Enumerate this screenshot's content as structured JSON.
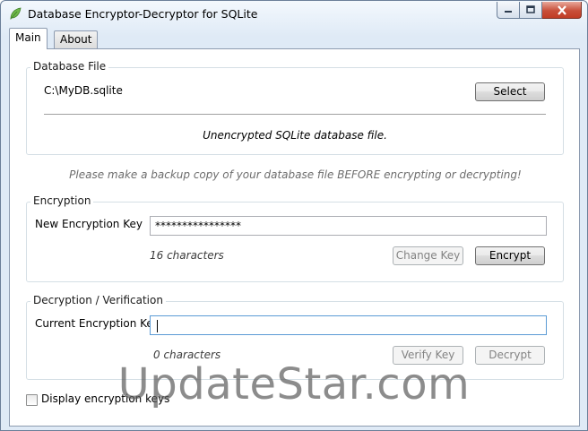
{
  "window": {
    "title": "Database Encryptor-Decryptor for SQLite",
    "icon": "leaf-icon",
    "close_color": "#c8503a"
  },
  "tabs": [
    {
      "label": "Main",
      "selected": true
    },
    {
      "label": "About",
      "selected": false
    }
  ],
  "database_file": {
    "group_title": "Database File",
    "path": "C:\\MyDB.sqlite",
    "select_label": "Select",
    "status": "Unencrypted SQLite database file."
  },
  "backup_warning": "Please make a backup copy of your database file BEFORE encrypting or decrypting!",
  "encryption": {
    "group_title": "Encryption",
    "key_label": "New Encryption Key",
    "key_value": "****************",
    "char_count": "16 characters",
    "change_key_label": "Change Key",
    "encrypt_label": "Encrypt"
  },
  "decryption": {
    "group_title": "Decryption / Verification",
    "key_label": "Current Encryption Key",
    "key_value": "",
    "char_count": "0 characters",
    "verify_label": "Verify Key",
    "decrypt_label": "Decrypt"
  },
  "display_keys_label": "Display encryption keys",
  "display_keys_checked": false,
  "watermark": "UpdateStar.com"
}
